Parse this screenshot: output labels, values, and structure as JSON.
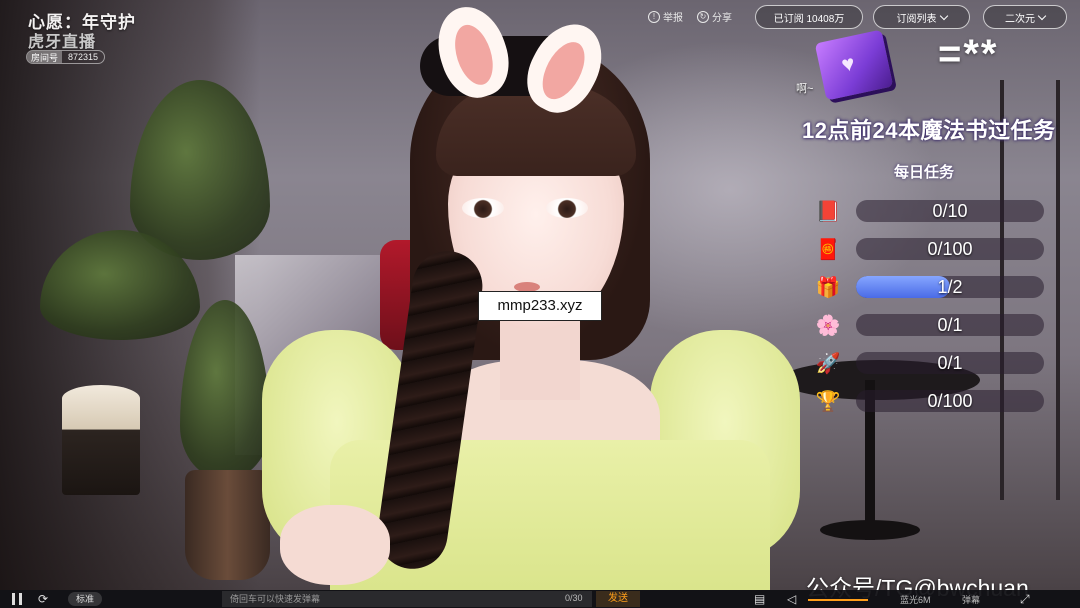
{
  "stream": {
    "wish_label": "心愿：年守护",
    "platform_logo": "虎牙直播",
    "room_id_label": "房间号",
    "room_id": "872315"
  },
  "topbar": {
    "report_label": "举报",
    "report_icon": "report-icon",
    "share_label": "分享",
    "share_icon": "share-icon",
    "subscribed_label": "已订阅 10408万",
    "sub_list_label": "订阅列表",
    "resolution_label": "二次元"
  },
  "overlay": {
    "stars_text": "=**",
    "exclaim": "啊~",
    "task_title": "12点前24本魔法书过任务",
    "daily_label": "每日任务",
    "tasks": [
      {
        "icon": "magic-book-icon",
        "glyph": "📕",
        "text": "0/10",
        "progress": 0
      },
      {
        "icon": "red-envelope-icon",
        "glyph": "🧧",
        "text": "0/100",
        "progress": 0
      },
      {
        "icon": "gift-icon",
        "glyph": "🎁",
        "text": "1/2",
        "progress": 0.5
      },
      {
        "icon": "flower-icon",
        "glyph": "🌸",
        "text": "0/1",
        "progress": 0
      },
      {
        "icon": "rocket-icon",
        "glyph": "🚀",
        "text": "0/1",
        "progress": 0
      },
      {
        "icon": "trophy-icon",
        "glyph": "🏆",
        "text": "0/100",
        "progress": 0
      }
    ],
    "watermark_url": "mmp233.xyz",
    "watermark_tg": "公众号/TG@bwchuan"
  },
  "controls": {
    "quality": "标准",
    "danmu_placeholder": "倚回车可以快速发弹幕",
    "counter": "0/30",
    "send_label": "发送",
    "hd_label": "蓝光6M",
    "danmu_toggle": "弹幕"
  },
  "colors": {
    "send_accent": "#ff9f1a",
    "progress_fill": "#4a6be6"
  }
}
